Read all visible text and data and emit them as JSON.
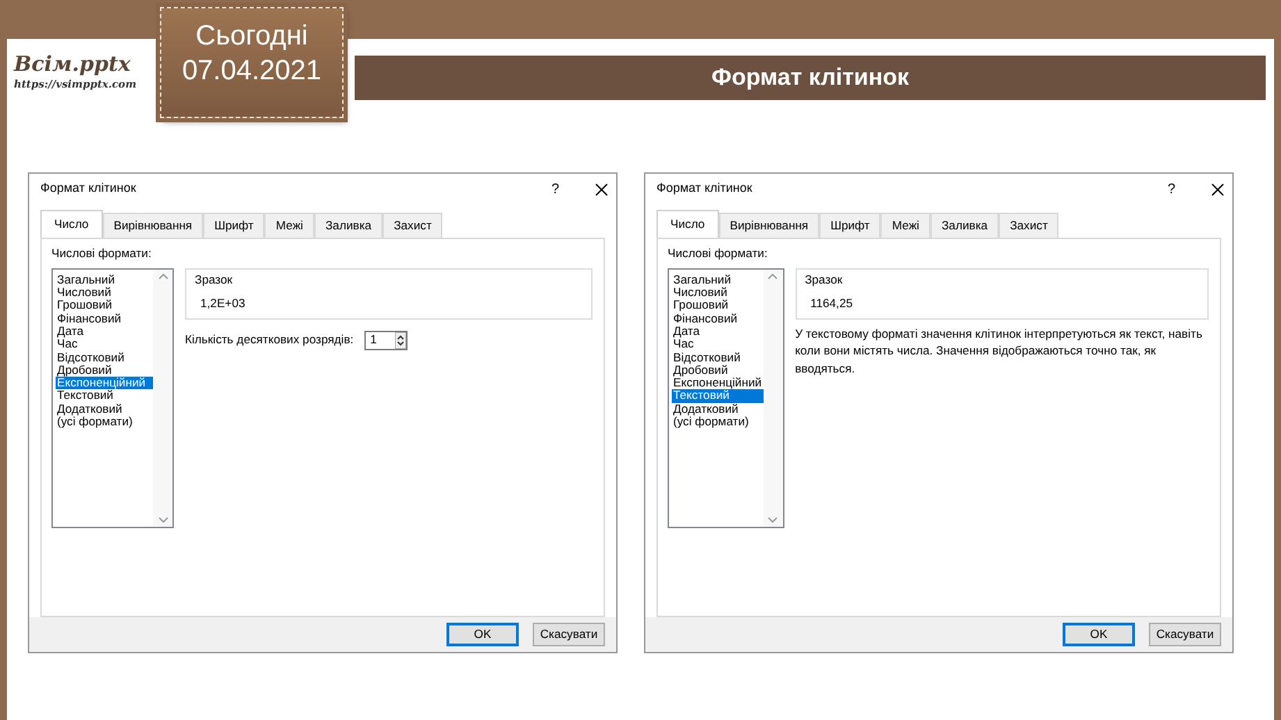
{
  "slide": {
    "logo": {
      "name": "Всім.pptx",
      "url": "https://vsimpptx.com"
    },
    "date_tag": {
      "label": "Сьогодні",
      "date": "07.04.2021"
    },
    "title": "Формат клітинок"
  },
  "dialogs": [
    {
      "title": "Формат клітинок",
      "help": "?",
      "tabs": [
        {
          "label": "Число",
          "selected": true
        },
        {
          "label": "Вирівнювання",
          "selected": false
        },
        {
          "label": "Шрифт",
          "selected": false
        },
        {
          "label": "Межі",
          "selected": false
        },
        {
          "label": "Заливка",
          "selected": false
        },
        {
          "label": "Захист",
          "selected": false
        }
      ],
      "list_label": "Числові формати:",
      "formats": [
        {
          "label": "Загальний",
          "selected": false
        },
        {
          "label": "Числовий",
          "selected": false
        },
        {
          "label": "Грошовий",
          "selected": false
        },
        {
          "label": "Фінансовий",
          "selected": false
        },
        {
          "label": "Дата",
          "selected": false
        },
        {
          "label": "Час",
          "selected": false
        },
        {
          "label": "Відсотковий",
          "selected": false
        },
        {
          "label": "Дробовий",
          "selected": false
        },
        {
          "label": "Експоненційний",
          "selected": true
        },
        {
          "label": "Текстовий",
          "selected": false
        },
        {
          "label": "Додатковий",
          "selected": false
        },
        {
          "label": "(усі формати)",
          "selected": false
        }
      ],
      "sample_label": "Зразок",
      "sample_value": "1,2E+03",
      "decimal_places": {
        "label": "Кількість десяткових розрядів:",
        "value": "1"
      },
      "buttons": [
        {
          "label": "OK",
          "default": true
        },
        {
          "label": "Скасувати",
          "default": false
        }
      ]
    },
    {
      "title": "Формат клітинок",
      "help": "?",
      "tabs": [
        {
          "label": "Число",
          "selected": true
        },
        {
          "label": "Вирівнювання",
          "selected": false
        },
        {
          "label": "Шрифт",
          "selected": false
        },
        {
          "label": "Межі",
          "selected": false
        },
        {
          "label": "Заливка",
          "selected": false
        },
        {
          "label": "Захист",
          "selected": false
        }
      ],
      "list_label": "Числові формати:",
      "formats": [
        {
          "label": "Загальний",
          "selected": false
        },
        {
          "label": "Числовий",
          "selected": false
        },
        {
          "label": "Грошовий",
          "selected": false
        },
        {
          "label": "Фінансовий",
          "selected": false
        },
        {
          "label": "Дата",
          "selected": false
        },
        {
          "label": "Час",
          "selected": false
        },
        {
          "label": "Відсотковий",
          "selected": false
        },
        {
          "label": "Дробовий",
          "selected": false
        },
        {
          "label": "Експоненційний",
          "selected": false
        },
        {
          "label": "Текстовий",
          "selected": true
        },
        {
          "label": "Додатковий",
          "selected": false
        },
        {
          "label": "(усі формати)",
          "selected": false
        }
      ],
      "sample_label": "Зразок",
      "sample_value": "1164,25",
      "description": "У текстовому форматі значення клітинок інтерпретуються як текст, навіть коли вони містять числа. Значення відображаються точно так, як вводяться.",
      "buttons": [
        {
          "label": "OK",
          "default": true
        },
        {
          "label": "Скасувати",
          "default": false
        }
      ]
    }
  ]
}
